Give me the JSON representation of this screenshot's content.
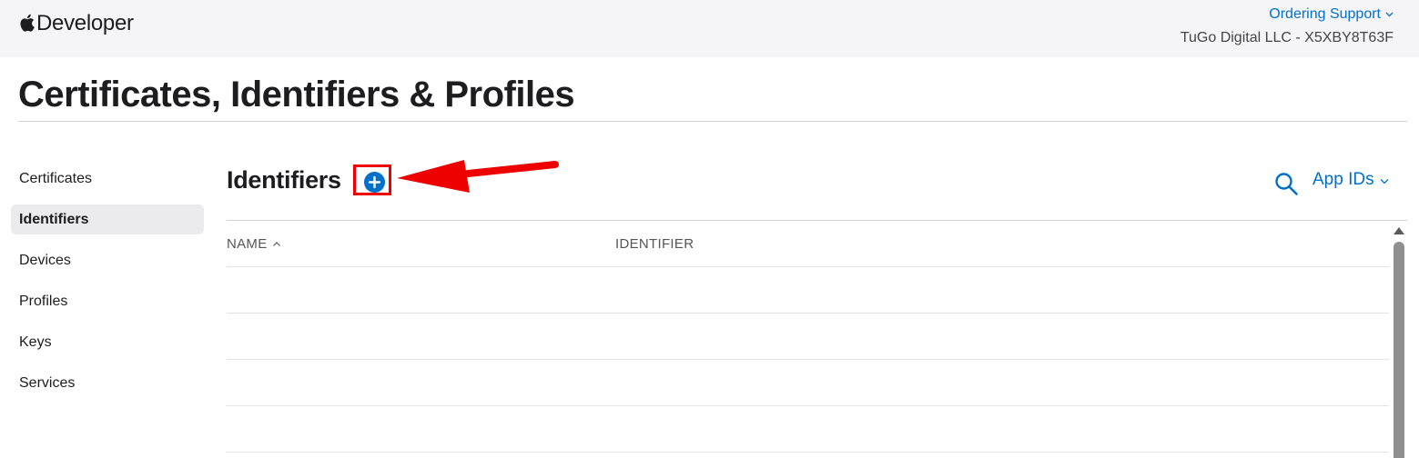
{
  "header": {
    "brand": "Developer",
    "ordering_support": "Ordering Support",
    "team": "TuGo Digital LLC - X5XBY8T63F"
  },
  "page_title": "Certificates, Identifiers & Profiles",
  "sidebar": {
    "items": [
      {
        "label": "Certificates",
        "active": false
      },
      {
        "label": "Identifiers",
        "active": true
      },
      {
        "label": "Devices",
        "active": false
      },
      {
        "label": "Profiles",
        "active": false
      },
      {
        "label": "Keys",
        "active": false
      },
      {
        "label": "Services",
        "active": false
      }
    ]
  },
  "section": {
    "title": "Identifiers",
    "filter": "App IDs"
  },
  "table": {
    "columns": [
      "NAME",
      "IDENTIFIER"
    ],
    "sorted_by": "NAME",
    "rows": []
  },
  "colors": {
    "accent": "#0070c9",
    "highlight": "#ee0000",
    "topbar": "#f5f5f7"
  },
  "icons": [
    "apple-logo-icon",
    "chevron-down-icon",
    "plus-circle-icon",
    "search-icon",
    "sort-ascending-icon",
    "annotation-arrow-icon",
    "scroll-up-arrow-icon"
  ]
}
